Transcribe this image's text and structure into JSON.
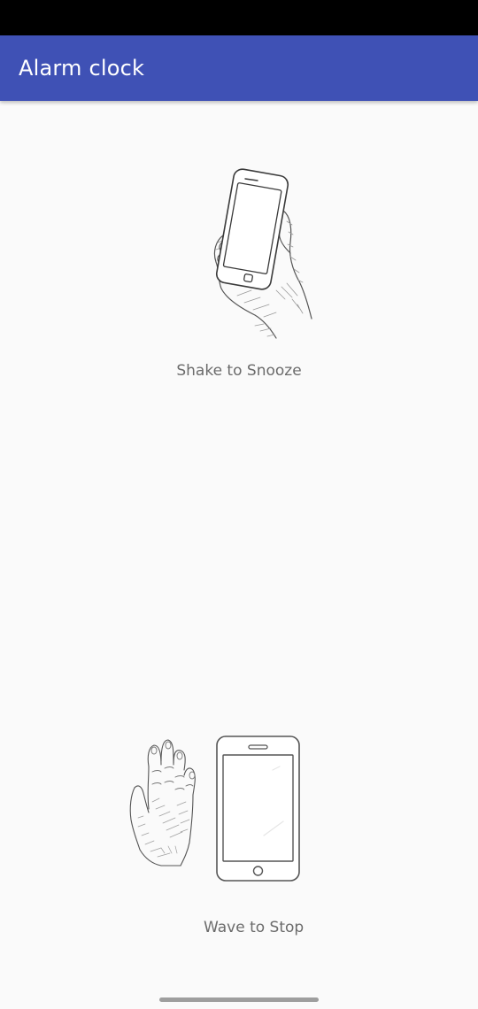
{
  "app_bar": {
    "title": "Alarm clock",
    "background_color": "#3f51b5"
  },
  "gestures": {
    "shake": {
      "label": "Shake to Snooze",
      "icon": "hand-holding-phone-icon"
    },
    "wave": {
      "label": "Wave to Stop",
      "icon": "hand-waving-over-phone-icon"
    }
  },
  "colors": {
    "status_bar": "#000000",
    "background": "#fafafa",
    "label_text": "#6b6b6b"
  }
}
